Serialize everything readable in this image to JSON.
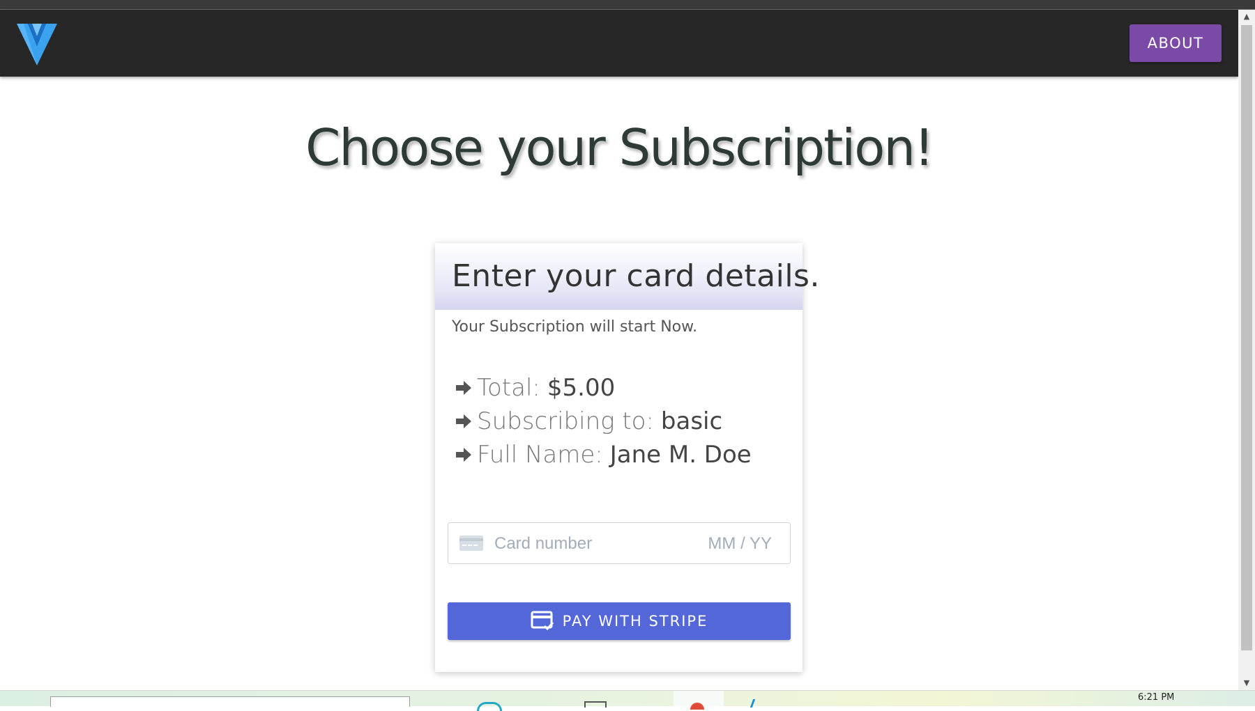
{
  "appbar": {
    "logo_icon": "v-logo-icon",
    "about_label": "ABOUT"
  },
  "main": {
    "title": "Choose your Subscription!"
  },
  "card": {
    "title": "Enter your card details.",
    "subtitle": "Your Subscription will start Now.",
    "details": [
      {
        "icon": "arrow-right-icon",
        "label": "Total:",
        "value": "$5.00"
      },
      {
        "icon": "arrow-right-icon",
        "label": "Subscribing to:",
        "value": "basic"
      },
      {
        "icon": "arrow-right-icon",
        "label": "Full Name:",
        "value": "Jane M. Doe"
      }
    ],
    "card_input": {
      "brand_icon": "credit-card-icon",
      "number_placeholder": "Card number",
      "expiry_placeholder": "MM / YY"
    },
    "pay_button": {
      "icon": "credit-card-check-icon",
      "label": "PAY WITH STRIPE"
    }
  },
  "taskbar": {
    "clock": "6:21 PM"
  },
  "colors": {
    "appbar_bg": "#272727",
    "about_button": "#7b4aa6",
    "pay_button": "#5367d8",
    "title_text": "#2d3a35"
  }
}
